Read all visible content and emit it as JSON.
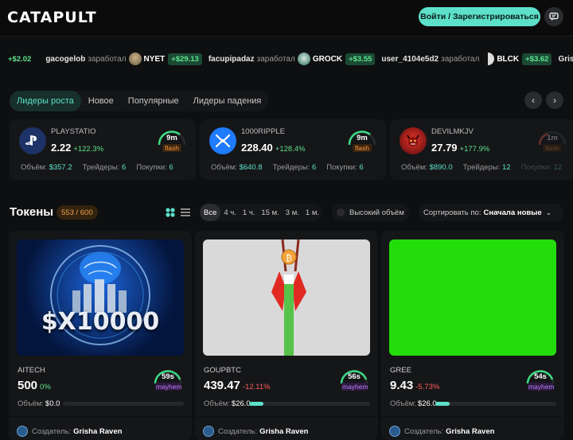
{
  "header": {
    "logo": "CATAPULT",
    "login_label": "Войти / Зарегистрироваться"
  },
  "ticker": [
    {
      "user": "",
      "verb": "",
      "coin": "",
      "amount": "+$2.02"
    },
    {
      "user": "gacogelob",
      "verb": "заработал",
      "coin": "NYET",
      "amount": "+$29.13"
    },
    {
      "user": "facupipadaz",
      "verb": "заработал",
      "coin": "GROCK",
      "amount": "+$3.55"
    },
    {
      "user": "user_4104e5d2",
      "verb": "заработал",
      "coin": "BLCK",
      "amount": "+$3.62"
    },
    {
      "user": "Grisha Raven",
      "verb": "",
      "coin": "",
      "amount": ""
    }
  ],
  "tabs": [
    "Лидеры роста",
    "Новое",
    "Популярные",
    "Лидеры падения"
  ],
  "top_cards": [
    {
      "name": "PLAYSTATIO",
      "price": "2.22",
      "change": "+122.3%",
      "time": "9m",
      "tag": "flash",
      "vol_label": "Объём:",
      "vol": "$357.2",
      "traders_label": "Трейдеры:",
      "traders": "6",
      "buys_label": "Покупки:",
      "buys": "6"
    },
    {
      "name": "1000RIPPLE",
      "price": "228.40",
      "change": "+128.4%",
      "time": "9m",
      "tag": "flash",
      "vol_label": "Объём:",
      "vol": "$640.8",
      "traders_label": "Трейдеры:",
      "traders": "6",
      "buys_label": "Покупки:",
      "buys": "6"
    },
    {
      "name": "DEVILMKJV",
      "price": "27.79",
      "change": "+177.9%",
      "time": "1m",
      "tag": "flash",
      "vol_label": "Объём:",
      "vol": "$890.0",
      "traders_label": "Трейдеры:",
      "traders": "12",
      "buys_label": "Покупки:",
      "buys": "12"
    }
  ],
  "tokens": {
    "title": "Токены",
    "count": "553 / 600",
    "filters": [
      "Все",
      "4 ч.",
      "1 ч.",
      "15 м.",
      "3 м.",
      "1 м."
    ],
    "high_volume": "Высокий объём",
    "sort_label": "Сортировать по:",
    "sort_value": "Сначала новые",
    "cards": [
      {
        "name": "AITECH",
        "price": "500",
        "change": "0%",
        "time": "59s",
        "tag": "mayhem",
        "vol_label": "Объём:",
        "vol": "$0.0",
        "progress": 0,
        "creator_label": "Создатель:",
        "creator": "Grisha Raven",
        "image_text": "$X10000"
      },
      {
        "name": "GOUPBTC",
        "price": "439.47",
        "change": "-12.11%",
        "time": "56s",
        "tag": "mayhem",
        "vol_label": "Объём:",
        "vol": "$26.0",
        "progress": 12,
        "creator_label": "Создатель:",
        "creator": "Grisha Raven"
      },
      {
        "name": "GREE",
        "price": "9.43",
        "change": "-5.73%",
        "time": "54s",
        "tag": "mayhem",
        "vol_label": "Объём:",
        "vol": "$26.0",
        "progress": 12,
        "creator_label": "Создатель:",
        "creator": "Grisha Raven"
      }
    ]
  }
}
